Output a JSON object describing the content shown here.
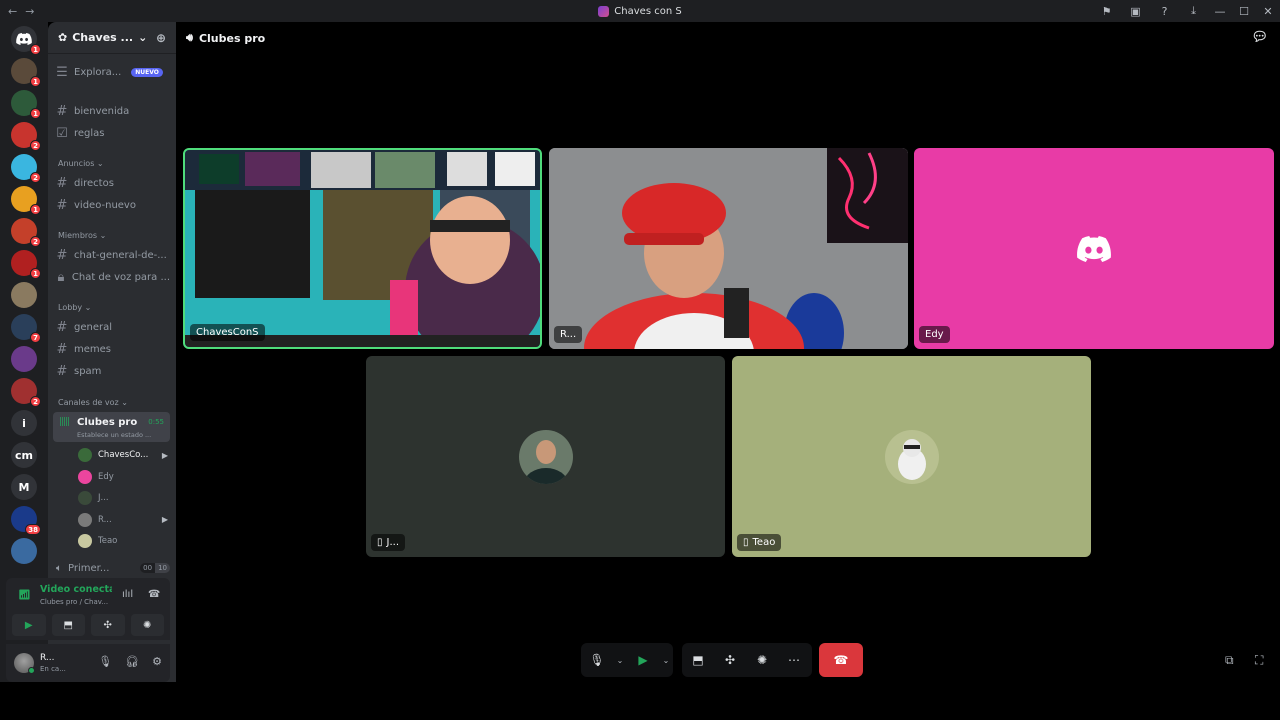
{
  "window": {
    "title": "Chaves con S",
    "back_glyph": "←",
    "forward_glyph": "→",
    "minimize": "—",
    "maximize": "☐",
    "close": "✕"
  },
  "guilds": [
    {
      "label": "",
      "badge": "1",
      "color": "#5a4a3a"
    },
    {
      "label": "",
      "badge": "1",
      "color": "#2d5a3a"
    },
    {
      "label": "",
      "badge": "2",
      "color": "#c8342e"
    },
    {
      "label": "",
      "badge": "2",
      "color": "#3ab6e0"
    },
    {
      "label": "",
      "badge": "1",
      "color": "#e8a020"
    },
    {
      "label": "",
      "badge": "2",
      "color": "#c4402a"
    },
    {
      "label": "",
      "badge": "1",
      "color": "#b02020"
    },
    {
      "label": "",
      "badge": "",
      "color": "#8a7a60"
    },
    {
      "label": "",
      "badge": "7",
      "color": "#2a3f5a"
    },
    {
      "label": "",
      "badge": "",
      "color": "#6a3a8a"
    },
    {
      "label": "",
      "badge": "2",
      "color": "#a03030"
    },
    {
      "label": "i",
      "badge": "",
      "color": "#313338"
    },
    {
      "label": "cm",
      "badge": "",
      "color": "#313338"
    },
    {
      "label": "M",
      "badge": "",
      "color": "#313338"
    },
    {
      "label": "",
      "badge": "38",
      "color": "#1a3a8a"
    },
    {
      "label": "",
      "badge": "",
      "color": "#3a6aa0"
    }
  ],
  "server": {
    "name": "Chaves ...",
    "explore_label": "Explora...",
    "explore_badge": "NUEVO"
  },
  "channels": {
    "top": [
      "bienvenida",
      "reglas"
    ],
    "cat_anuncios": "Anuncios",
    "anuncios": [
      "directos",
      "video-nuevo"
    ],
    "cat_miembros": "Miembros",
    "miembros_text": "chat-general-de-...",
    "miembros_voice": "Chat de voz para ...",
    "cat_lobby": "Lobby",
    "lobby": [
      "general",
      "memes",
      "spam"
    ],
    "cat_voz": "Canales de voz",
    "active_voice": {
      "name": "Clubes pro",
      "time": "0:55",
      "status": "Establece un estado ..."
    },
    "voice_users": [
      {
        "name": "ChavesCo...",
        "color": "#3a6a3a",
        "cam": true,
        "active": true
      },
      {
        "name": "Edy",
        "color": "#eb459e",
        "cam": false,
        "active": false
      },
      {
        "name": "J...",
        "color": "#3a4a3a",
        "cam": false,
        "active": false
      },
      {
        "name": "R...",
        "color": "#7a7a7a",
        "cam": true,
        "active": false
      },
      {
        "name": "Teao",
        "color": "#c8c8a0",
        "cam": false,
        "active": false
      }
    ],
    "last_channel": {
      "name": "Primer...",
      "count_a": "00",
      "count_b": "10"
    }
  },
  "voice_panel": {
    "status": "Video conectado",
    "sub": "Clubes pro / Chav..."
  },
  "user_panel": {
    "name": "R...",
    "status": "En ca..."
  },
  "stage": {
    "channel_name": "Clubes pro"
  },
  "tiles": [
    {
      "name": "ChavesConS",
      "bg": "#2a8a8a",
      "speaking": true
    },
    {
      "name": "R...",
      "bg": "#8a8a8a",
      "speaking": false
    },
    {
      "name": "Edy",
      "bg": "#e83ba6",
      "speaking": false
    },
    {
      "name": "J...",
      "bg": "#2d332f",
      "speaking": false
    },
    {
      "name": "Teao",
      "bg": "#a5b07b",
      "speaking": false
    }
  ],
  "colors": {
    "accent": "#5865f2",
    "online": "#23a55a",
    "danger": "#da373c"
  }
}
